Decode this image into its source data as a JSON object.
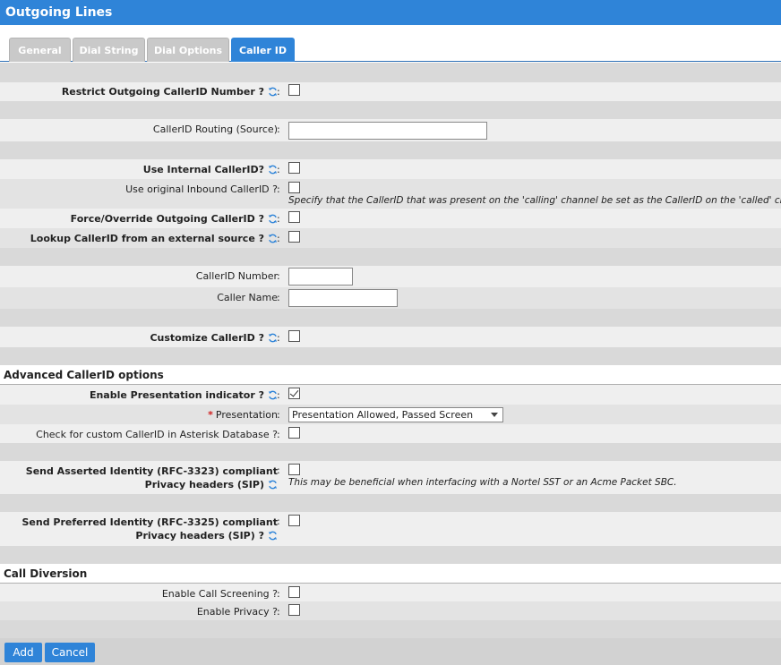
{
  "window": {
    "title": "Outgoing Lines"
  },
  "tabs": [
    {
      "label": "General"
    },
    {
      "label": "Dial String"
    },
    {
      "label": "Dial Options"
    },
    {
      "label": "Caller ID"
    }
  ],
  "fields": {
    "restrict_callerid": {
      "label": "Restrict Outgoing CallerID Number ?",
      "checked": false
    },
    "callerid_routing": {
      "label": "CallerID Routing (Source)",
      "value": ""
    },
    "use_internal": {
      "label": "Use Internal CallerID?",
      "checked": false
    },
    "use_original_inbound": {
      "label": "Use original Inbound CallerID ?",
      "checked": false,
      "hint": "Specify that the CallerID that was present on the 'calling' channel be set as the CallerID on the 'called' channel."
    },
    "force_override": {
      "label": "Force/Override Outgoing CallerID ?",
      "checked": false
    },
    "lookup_external": {
      "label": "Lookup CallerID from an external source ?",
      "checked": false
    },
    "callerid_number": {
      "label": "CallerID Number",
      "value": ""
    },
    "caller_name": {
      "label": "Caller Name",
      "value": ""
    },
    "customize_callerid": {
      "label": "Customize CallerID ?",
      "checked": false
    }
  },
  "advanced": {
    "title": "Advanced CallerID options",
    "presentation_indicator": {
      "label": "Enable Presentation indicator ?",
      "checked": true
    },
    "presentation": {
      "label": "Presentation",
      "value": "Presentation Allowed, Passed Screen"
    },
    "custom_callerid_db": {
      "label": "Check for custom CallerID in Asterisk Database ?",
      "checked": false
    },
    "asserted_identity": {
      "label": "Send Asserted Identity (RFC-3323) compliant Privacy headers (SIP)",
      "checked": false,
      "hint": "This may be beneficial when interfacing with a Nortel SST or an Acme Packet SBC."
    },
    "preferred_identity": {
      "label": "Send Preferred Identity (RFC-3325) compliant Privacy headers (SIP) ?",
      "checked": false
    }
  },
  "diversion": {
    "title": "Call Diversion",
    "call_screening": {
      "label": "Enable Call Screening ?",
      "checked": false
    },
    "privacy": {
      "label": "Enable Privacy ?",
      "checked": false
    }
  },
  "buttons": {
    "add": "Add",
    "cancel": "Cancel"
  },
  "colors": {
    "accent": "#2f84d8",
    "required": "#d02020"
  },
  "icons": {
    "help": "sync-help-icon"
  }
}
